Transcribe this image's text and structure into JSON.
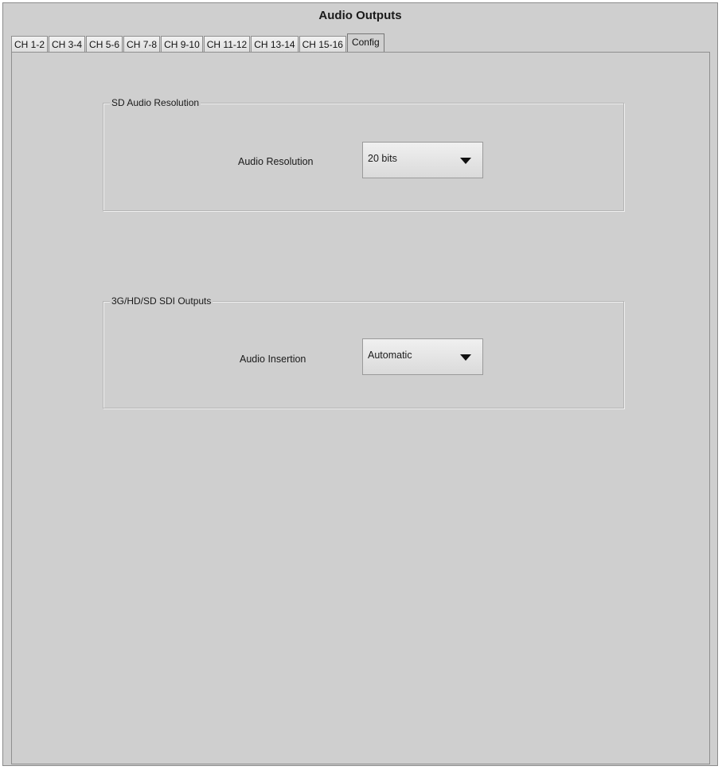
{
  "window": {
    "title": "Audio Outputs"
  },
  "tabs": [
    {
      "label": "CH 1-2",
      "active": false
    },
    {
      "label": "CH 3-4",
      "active": false
    },
    {
      "label": "CH 5-6",
      "active": false
    },
    {
      "label": "CH 7-8",
      "active": false
    },
    {
      "label": "CH 9-10",
      "active": false
    },
    {
      "label": "CH 11-12",
      "active": false
    },
    {
      "label": "CH 13-14",
      "active": false
    },
    {
      "label": "CH 15-16",
      "active": false
    },
    {
      "label": "Config",
      "active": true
    }
  ],
  "sd_group": {
    "title": "SD Audio Resolution",
    "field_label": "Audio Resolution",
    "selected": "20 bits"
  },
  "sdi_group": {
    "title": "3G/HD/SD SDI Outputs",
    "field_label": "Audio Insertion",
    "selected": "Automatic"
  },
  "icons": {
    "dropdown_arrow": "chevron-down-icon"
  },
  "colors": {
    "panel_bg": "#cfcfcf",
    "tab_bg": "#e6e6e6",
    "border": "#8f8f8f"
  }
}
